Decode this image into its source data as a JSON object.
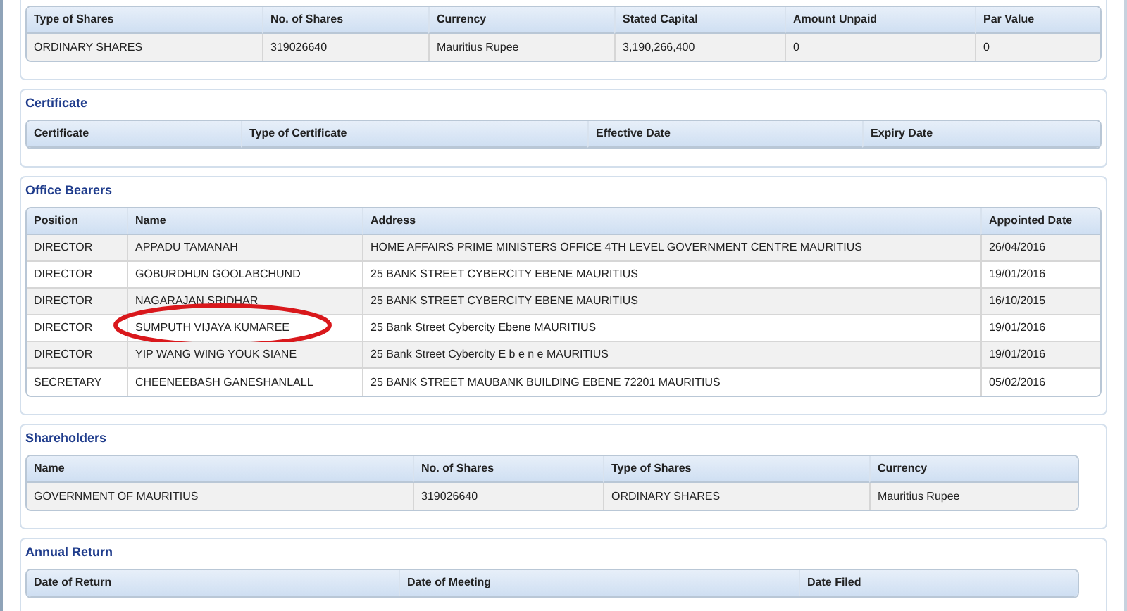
{
  "sections": [
    {
      "columns": [
        "Type of Shares",
        "No. of Shares",
        "Currency",
        "Stated Capital",
        "Amount Unpaid",
        "Par Value"
      ],
      "rows": [
        {
          "cells": [
            "ORDINARY SHARES",
            "319026640",
            "Mauritius Rupee",
            "3,190,266,400",
            "0",
            "0"
          ],
          "circled": false
        }
      ]
    },
    {
      "title": "Certificate",
      "columns": [
        "Certificate",
        "Type of Certificate",
        "Effective Date",
        "Expiry Date"
      ]
    },
    {
      "title": "Office Bearers",
      "columns": [
        "Position",
        "Name",
        "Address",
        "Appointed Date"
      ],
      "rows": [
        {
          "cells": [
            "DIRECTOR",
            "APPADU TAMANAH",
            "HOME AFFAIRS PRIME MINISTERS OFFICE 4TH LEVEL GOVERNMENT CENTRE MAURITIUS",
            "26/04/2016"
          ],
          "circled": false
        },
        {
          "cells": [
            "DIRECTOR",
            "GOBURDHUN GOOLABCHUND",
            "25 BANK STREET CYBERCITY EBENE MAURITIUS",
            "19/01/2016"
          ],
          "circled": false
        },
        {
          "cells": [
            "DIRECTOR",
            "NAGARAJAN SRIDHAR",
            "25 BANK STREET CYBERCITY EBENE MAURITIUS",
            "16/10/2015"
          ],
          "circled": false
        },
        {
          "cells": [
            "DIRECTOR",
            "SUMPUTH VIJAYA KUMAREE",
            "25 Bank Street Cybercity Ebene MAURITIUS",
            "19/01/2016"
          ],
          "circled": true
        },
        {
          "cells": [
            "DIRECTOR",
            "YIP WANG WING YOUK SIANE",
            "25 Bank Street Cybercity E b e n e MAURITIUS",
            "19/01/2016"
          ],
          "circled": false
        },
        {
          "cells": [
            "SECRETARY",
            "CHEENEEBASH GANESHANLALL",
            "25 BANK STREET MAUBANK BUILDING EBENE 72201 MAURITIUS",
            "05/02/2016"
          ],
          "circled": false
        }
      ]
    },
    {
      "title": "Shareholders",
      "columns": [
        "Name",
        "No. of Shares",
        "Type of Shares",
        "Currency"
      ],
      "rows": [
        {
          "cells": [
            "GOVERNMENT OF MAURITIUS",
            "319026640",
            "ORDINARY SHARES",
            "Mauritius Rupee"
          ],
          "circled": false
        }
      ]
    },
    {
      "title": "Annual Return",
      "columns": [
        "Date of Return",
        "Date of Meeting",
        "Date Filed"
      ]
    }
  ]
}
